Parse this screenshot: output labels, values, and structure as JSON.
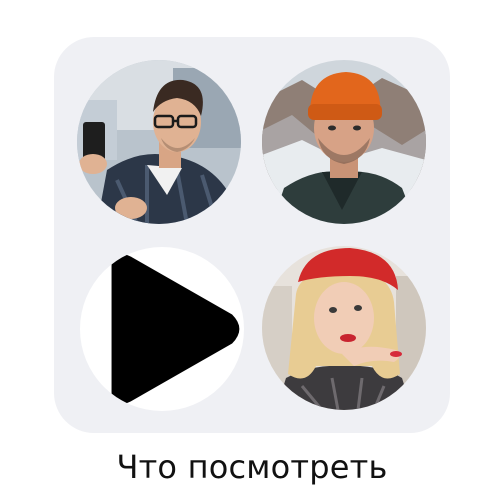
{
  "widget": {
    "caption": "Что посмотреть",
    "items": [
      {
        "name": "creator-avatar-man-glasses"
      },
      {
        "name": "creator-avatar-man-orange-beanie"
      },
      {
        "name": "play-button"
      },
      {
        "name": "creator-avatar-woman-red-beret"
      }
    ]
  },
  "colors": {
    "tile": "#eff0f4",
    "caption": "#111111",
    "play": "#000000",
    "beanie": "#e2661c",
    "beret": "#d22a2a"
  }
}
